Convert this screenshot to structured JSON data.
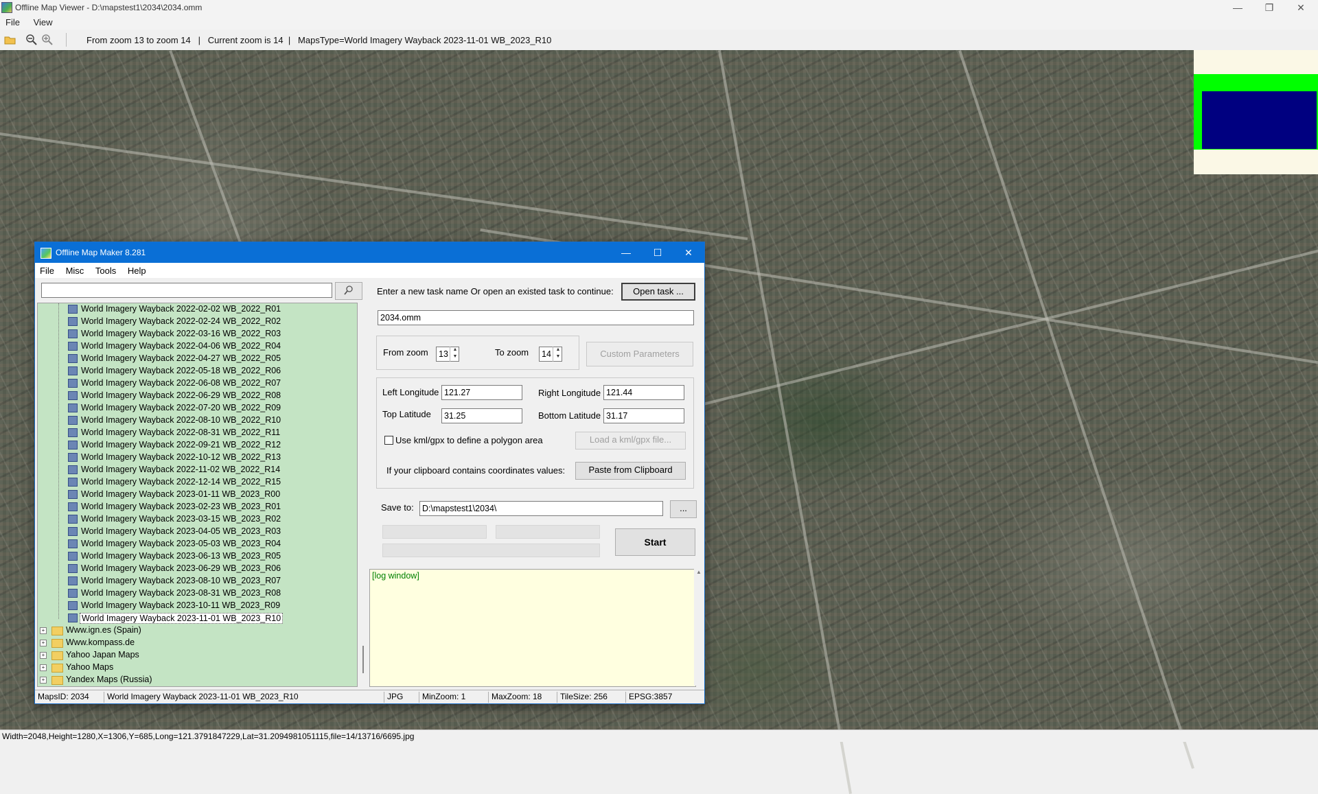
{
  "window": {
    "title": "Offline Map Viewer - D:\\mapstest1\\2034\\2034.omm",
    "menu": [
      "File",
      "View"
    ],
    "toolbar_info": "From zoom 13 to zoom 14   |   Current zoom is 14  |   MapsType=World Imagery Wayback 2023-11-01 WB_2023_R10",
    "status": "Width=2048,Height=1280,X=1306,Y=685,Long=121.3791847229,Lat=31.2094981051115,file=14/13716/6695.jpg",
    "controls": {
      "minimize": "—",
      "maximize": "❐",
      "close": "✕"
    }
  },
  "dialog": {
    "title": "Offline Map Maker 8.281",
    "menu": [
      "File",
      "Misc",
      "Tools",
      "Help"
    ],
    "search_placeholder": "",
    "search_icon": "magnifier-icon",
    "tree_items": [
      "World Imagery Wayback 2022-02-02 WB_2022_R01",
      "World Imagery Wayback 2022-02-24 WB_2022_R02",
      "World Imagery Wayback 2022-03-16 WB_2022_R03",
      "World Imagery Wayback 2022-04-06 WB_2022_R04",
      "World Imagery Wayback 2022-04-27 WB_2022_R05",
      "World Imagery Wayback 2022-05-18 WB_2022_R06",
      "World Imagery Wayback 2022-06-08 WB_2022_R07",
      "World Imagery Wayback 2022-06-29 WB_2022_R08",
      "World Imagery Wayback 2022-07-20 WB_2022_R09",
      "World Imagery Wayback 2022-08-10 WB_2022_R10",
      "World Imagery Wayback 2022-08-31 WB_2022_R11",
      "World Imagery Wayback 2022-09-21 WB_2022_R12",
      "World Imagery Wayback 2022-10-12 WB_2022_R13",
      "World Imagery Wayback 2022-11-02 WB_2022_R14",
      "World Imagery Wayback 2022-12-14 WB_2022_R15",
      "World Imagery Wayback 2023-01-11 WB_2023_R00",
      "World Imagery Wayback 2023-02-23 WB_2023_R01",
      "World Imagery Wayback 2023-03-15 WB_2023_R02",
      "World Imagery Wayback 2023-04-05 WB_2023_R03",
      "World Imagery Wayback 2023-05-03 WB_2023_R04",
      "World Imagery Wayback 2023-06-13 WB_2023_R05",
      "World Imagery Wayback 2023-06-29 WB_2023_R06",
      "World Imagery Wayback 2023-08-10 WB_2023_R07",
      "World Imagery Wayback 2023-08-31 WB_2023_R08",
      "World Imagery Wayback 2023-10-11 WB_2023_R09",
      "World Imagery Wayback 2023-11-01 WB_2023_R10"
    ],
    "tree_selected_index": 25,
    "tree_folders": [
      "Www.ign.es (Spain)",
      "Www.kompass.de",
      "Yahoo Japan Maps",
      "Yahoo Maps",
      "Yandex Maps (Russia)"
    ],
    "task_prompt": "Enter a new task name Or open an existed task to continue:",
    "open_task_button": "Open task ...",
    "task_name": "2034.omm",
    "from_zoom_label": "From zoom",
    "from_zoom": "13",
    "to_zoom_label": "To zoom",
    "to_zoom": "14",
    "custom_params_button": "Custom Parameters",
    "left_lon_label": "Left Longitude",
    "left_lon": "121.27",
    "right_lon_label": "Right Longitude",
    "right_lon": "121.44",
    "top_lat_label": "Top Latitude",
    "top_lat": "31.25",
    "bottom_lat_label": "Bottom Latitude",
    "bottom_lat": "31.17",
    "kml_checkbox_label": "Use kml/gpx to define a polygon area",
    "load_kml_button": "Load a kml/gpx file...",
    "clipboard_label": "If your clipboard contains coordinates values:",
    "paste_button": "Paste from Clipboard",
    "save_to_label": "Save to:",
    "save_to": "D:\\mapstest1\\2034\\",
    "browse_button": "...",
    "start_button": "Start",
    "log_text": "[log window]",
    "status": {
      "maps_id": "MapsID: 2034",
      "maps_name": "World Imagery Wayback 2023-11-01 WB_2023_R10",
      "format": "JPG",
      "min_zoom": "MinZoom: 1",
      "max_zoom": "MaxZoom: 18",
      "tile_size": "TileSize: 256",
      "epsg": "EPSG:3857"
    }
  },
  "colors": {
    "dialog_titlebar": "#0a6fd6",
    "tree_background": "#c4e4c4",
    "log_background": "#ffffe0",
    "log_text": "#008000",
    "overview_green": "#00ff00",
    "overview_blue": "#000080"
  }
}
